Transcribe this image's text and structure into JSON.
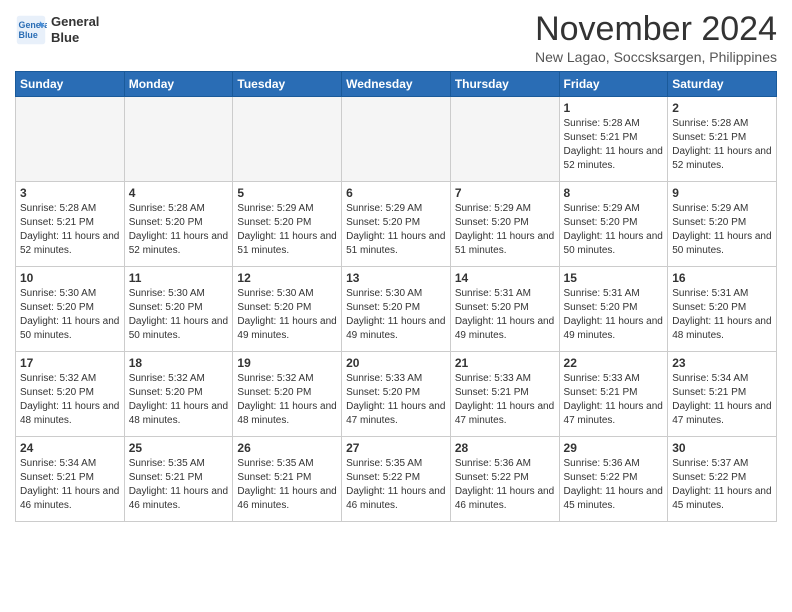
{
  "header": {
    "month_title": "November 2024",
    "location": "New Lagao, Soccsksargen, Philippines",
    "logo_line1": "General",
    "logo_line2": "Blue"
  },
  "weekdays": [
    "Sunday",
    "Monday",
    "Tuesday",
    "Wednesday",
    "Thursday",
    "Friday",
    "Saturday"
  ],
  "weeks": [
    [
      {
        "day": "",
        "empty": true
      },
      {
        "day": "",
        "empty": true
      },
      {
        "day": "",
        "empty": true
      },
      {
        "day": "",
        "empty": true
      },
      {
        "day": "",
        "empty": true
      },
      {
        "day": "1",
        "sunrise": "5:28 AM",
        "sunset": "5:21 PM",
        "daylight": "11 hours and 52 minutes."
      },
      {
        "day": "2",
        "sunrise": "5:28 AM",
        "sunset": "5:21 PM",
        "daylight": "11 hours and 52 minutes."
      }
    ],
    [
      {
        "day": "3",
        "sunrise": "5:28 AM",
        "sunset": "5:21 PM",
        "daylight": "11 hours and 52 minutes."
      },
      {
        "day": "4",
        "sunrise": "5:28 AM",
        "sunset": "5:20 PM",
        "daylight": "11 hours and 52 minutes."
      },
      {
        "day": "5",
        "sunrise": "5:29 AM",
        "sunset": "5:20 PM",
        "daylight": "11 hours and 51 minutes."
      },
      {
        "day": "6",
        "sunrise": "5:29 AM",
        "sunset": "5:20 PM",
        "daylight": "11 hours and 51 minutes."
      },
      {
        "day": "7",
        "sunrise": "5:29 AM",
        "sunset": "5:20 PM",
        "daylight": "11 hours and 51 minutes."
      },
      {
        "day": "8",
        "sunrise": "5:29 AM",
        "sunset": "5:20 PM",
        "daylight": "11 hours and 50 minutes."
      },
      {
        "day": "9",
        "sunrise": "5:29 AM",
        "sunset": "5:20 PM",
        "daylight": "11 hours and 50 minutes."
      }
    ],
    [
      {
        "day": "10",
        "sunrise": "5:30 AM",
        "sunset": "5:20 PM",
        "daylight": "11 hours and 50 minutes."
      },
      {
        "day": "11",
        "sunrise": "5:30 AM",
        "sunset": "5:20 PM",
        "daylight": "11 hours and 50 minutes."
      },
      {
        "day": "12",
        "sunrise": "5:30 AM",
        "sunset": "5:20 PM",
        "daylight": "11 hours and 49 minutes."
      },
      {
        "day": "13",
        "sunrise": "5:30 AM",
        "sunset": "5:20 PM",
        "daylight": "11 hours and 49 minutes."
      },
      {
        "day": "14",
        "sunrise": "5:31 AM",
        "sunset": "5:20 PM",
        "daylight": "11 hours and 49 minutes."
      },
      {
        "day": "15",
        "sunrise": "5:31 AM",
        "sunset": "5:20 PM",
        "daylight": "11 hours and 49 minutes."
      },
      {
        "day": "16",
        "sunrise": "5:31 AM",
        "sunset": "5:20 PM",
        "daylight": "11 hours and 48 minutes."
      }
    ],
    [
      {
        "day": "17",
        "sunrise": "5:32 AM",
        "sunset": "5:20 PM",
        "daylight": "11 hours and 48 minutes."
      },
      {
        "day": "18",
        "sunrise": "5:32 AM",
        "sunset": "5:20 PM",
        "daylight": "11 hours and 48 minutes."
      },
      {
        "day": "19",
        "sunrise": "5:32 AM",
        "sunset": "5:20 PM",
        "daylight": "11 hours and 48 minutes."
      },
      {
        "day": "20",
        "sunrise": "5:33 AM",
        "sunset": "5:20 PM",
        "daylight": "11 hours and 47 minutes."
      },
      {
        "day": "21",
        "sunrise": "5:33 AM",
        "sunset": "5:21 PM",
        "daylight": "11 hours and 47 minutes."
      },
      {
        "day": "22",
        "sunrise": "5:33 AM",
        "sunset": "5:21 PM",
        "daylight": "11 hours and 47 minutes."
      },
      {
        "day": "23",
        "sunrise": "5:34 AM",
        "sunset": "5:21 PM",
        "daylight": "11 hours and 47 minutes."
      }
    ],
    [
      {
        "day": "24",
        "sunrise": "5:34 AM",
        "sunset": "5:21 PM",
        "daylight": "11 hours and 46 minutes."
      },
      {
        "day": "25",
        "sunrise": "5:35 AM",
        "sunset": "5:21 PM",
        "daylight": "11 hours and 46 minutes."
      },
      {
        "day": "26",
        "sunrise": "5:35 AM",
        "sunset": "5:21 PM",
        "daylight": "11 hours and 46 minutes."
      },
      {
        "day": "27",
        "sunrise": "5:35 AM",
        "sunset": "5:22 PM",
        "daylight": "11 hours and 46 minutes."
      },
      {
        "day": "28",
        "sunrise": "5:36 AM",
        "sunset": "5:22 PM",
        "daylight": "11 hours and 46 minutes."
      },
      {
        "day": "29",
        "sunrise": "5:36 AM",
        "sunset": "5:22 PM",
        "daylight": "11 hours and 45 minutes."
      },
      {
        "day": "30",
        "sunrise": "5:37 AM",
        "sunset": "5:22 PM",
        "daylight": "11 hours and 45 minutes."
      }
    ]
  ],
  "labels": {
    "sunrise": "Sunrise:",
    "sunset": "Sunset:",
    "daylight": "Daylight:"
  }
}
